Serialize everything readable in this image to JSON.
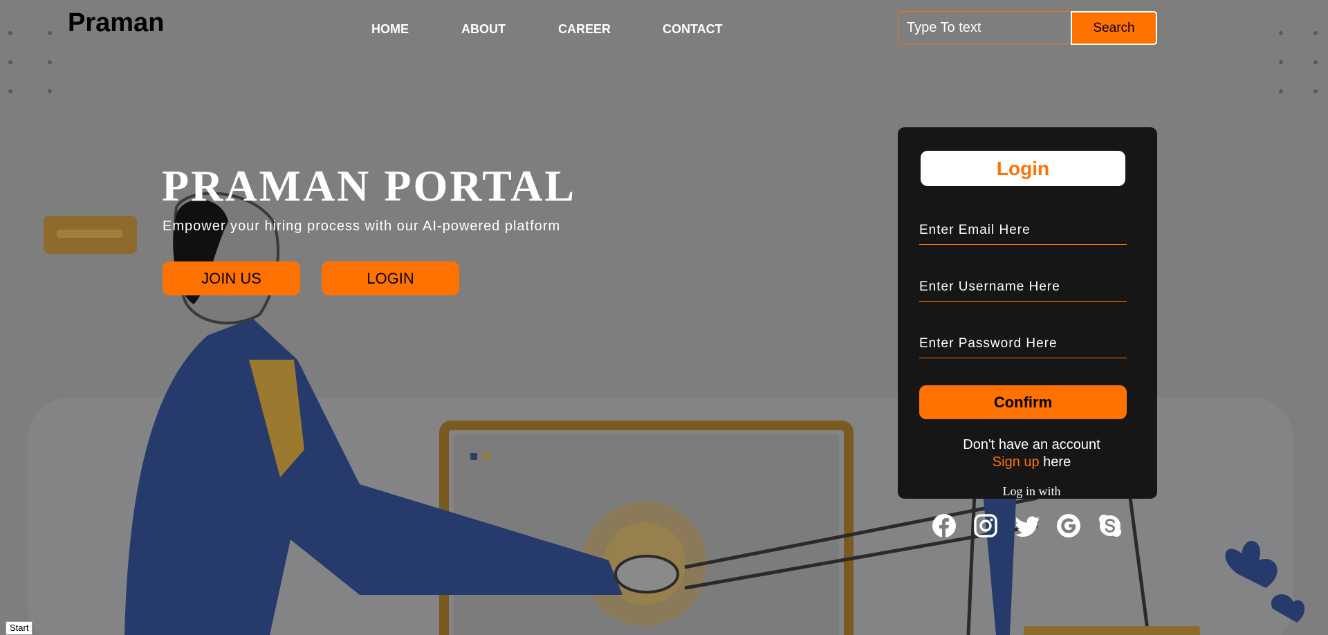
{
  "brand": "Praman",
  "nav": {
    "items": [
      {
        "label": "HOME"
      },
      {
        "label": "ABOUT"
      },
      {
        "label": "CAREER"
      },
      {
        "label": "CONTACT"
      }
    ]
  },
  "search": {
    "placeholder": "Type To text",
    "button_label": "Search"
  },
  "hero": {
    "title": "PRAMAN PORTAL",
    "subtitle": "Empower your hiring process with our AI-powered platform",
    "join_label": "JOIN US",
    "login_label": "LOGIN"
  },
  "login_card": {
    "title": "Login",
    "email_placeholder": "Enter Email Here",
    "username_placeholder": "Enter Username Here",
    "password_placeholder": "Enter Password Here",
    "confirm_label": "Confirm",
    "no_account_text": "Don't have an account",
    "signup_link": "Sign up",
    "signup_suffix": " here",
    "login_with": "Log in with"
  },
  "social_icons": [
    "facebook-icon",
    "instagram-icon",
    "twitter-icon",
    "google-icon",
    "skype-icon"
  ],
  "start_label": "Start",
  "colors": {
    "accent": "#ff7200",
    "card_bg": "#161616",
    "page_overlay": "#7e7e7e",
    "suit_blue": "#263b6b"
  }
}
